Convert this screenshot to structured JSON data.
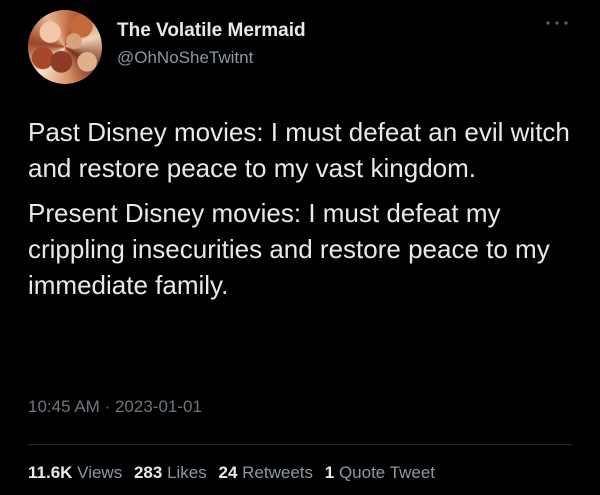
{
  "user": {
    "display_name": "The Volatile Mermaid",
    "handle": "@OhNoSheTwitnt",
    "avatar": "profile-photo"
  },
  "menu_icon": "more-dots-icon",
  "tweet": {
    "paragraphs": [
      "Past Disney movies: I must defeat an evil witch and restore peace to my vast kingdom.",
      "Present Disney movies: I must defeat my crippling insecurities and restore peace to my immediate family."
    ],
    "time": "10:45 AM",
    "separator": "·",
    "date": "2023-01-01"
  },
  "stats": [
    {
      "value": "11.6K",
      "label": "Views"
    },
    {
      "value": "283",
      "label": "Likes"
    },
    {
      "value": "24",
      "label": "Retweets"
    },
    {
      "value": "1",
      "label": "Quote Tweet"
    }
  ],
  "colors": {
    "background": "#000000",
    "primary_text": "#e7e9ea",
    "secondary_text": "#8b98a5",
    "divider": "#2b2f33"
  }
}
